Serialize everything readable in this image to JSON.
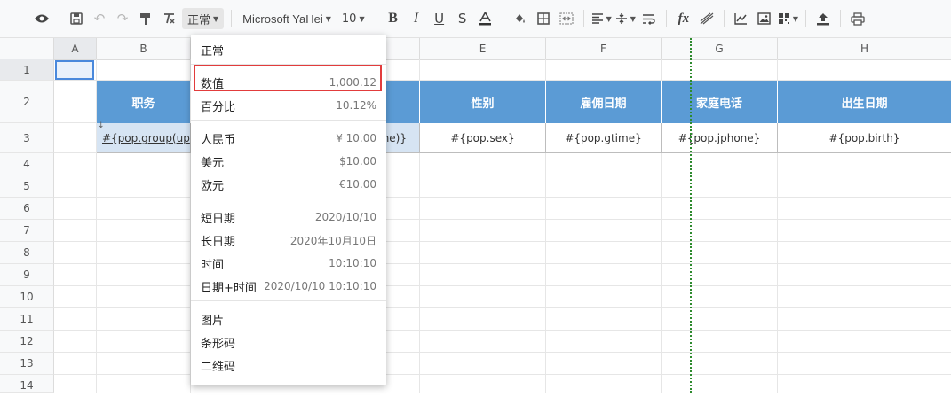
{
  "toolbar": {
    "format_label": "正常",
    "font_label": "Microsoft YaHei",
    "size_label": "10"
  },
  "grid": {
    "columns": [
      "A",
      "B",
      "C",
      "D",
      "E",
      "F",
      "G",
      "H"
    ],
    "rows": [
      "1",
      "2",
      "3",
      "4",
      "5",
      "6",
      "7",
      "8",
      "9",
      "10",
      "11",
      "12",
      "13",
      "14"
    ],
    "headers": [
      "职务",
      "",
      "性别",
      "雇佣日期",
      "家庭电话",
      "出生日期"
    ],
    "row3": [
      "#{pop.group(up",
      "me)}",
      "#{pop.sex}",
      "#{pop.gtime}",
      "#{pop.jphone}",
      "#{pop.birth}"
    ]
  },
  "format_menu": {
    "groups": [
      [
        {
          "label": "正常",
          "value": ""
        }
      ],
      [
        {
          "label": "数值",
          "value": "1,000.12"
        },
        {
          "label": "百分比",
          "value": "10.12%"
        }
      ],
      [
        {
          "label": "人民币",
          "value": "¥ 10.00"
        },
        {
          "label": "美元",
          "value": "$10.00"
        },
        {
          "label": "欧元",
          "value": "€10.00"
        }
      ],
      [
        {
          "label": "短日期",
          "value": "2020/10/10"
        },
        {
          "label": "长日期",
          "value": "2020年10月10日"
        },
        {
          "label": "时间",
          "value": "10:10:10"
        },
        {
          "label": "日期+时间",
          "value": "2020/10/10 10:10:10"
        }
      ],
      [
        {
          "label": "图片",
          "value": ""
        },
        {
          "label": "条形码",
          "value": ""
        },
        {
          "label": "二维码",
          "value": ""
        }
      ]
    ]
  },
  "colors": {
    "header_fill": "#5b9bd5",
    "highlight": "#e23c3c",
    "page_break": "#2e8b2e",
    "selection": "#4a89dc"
  }
}
